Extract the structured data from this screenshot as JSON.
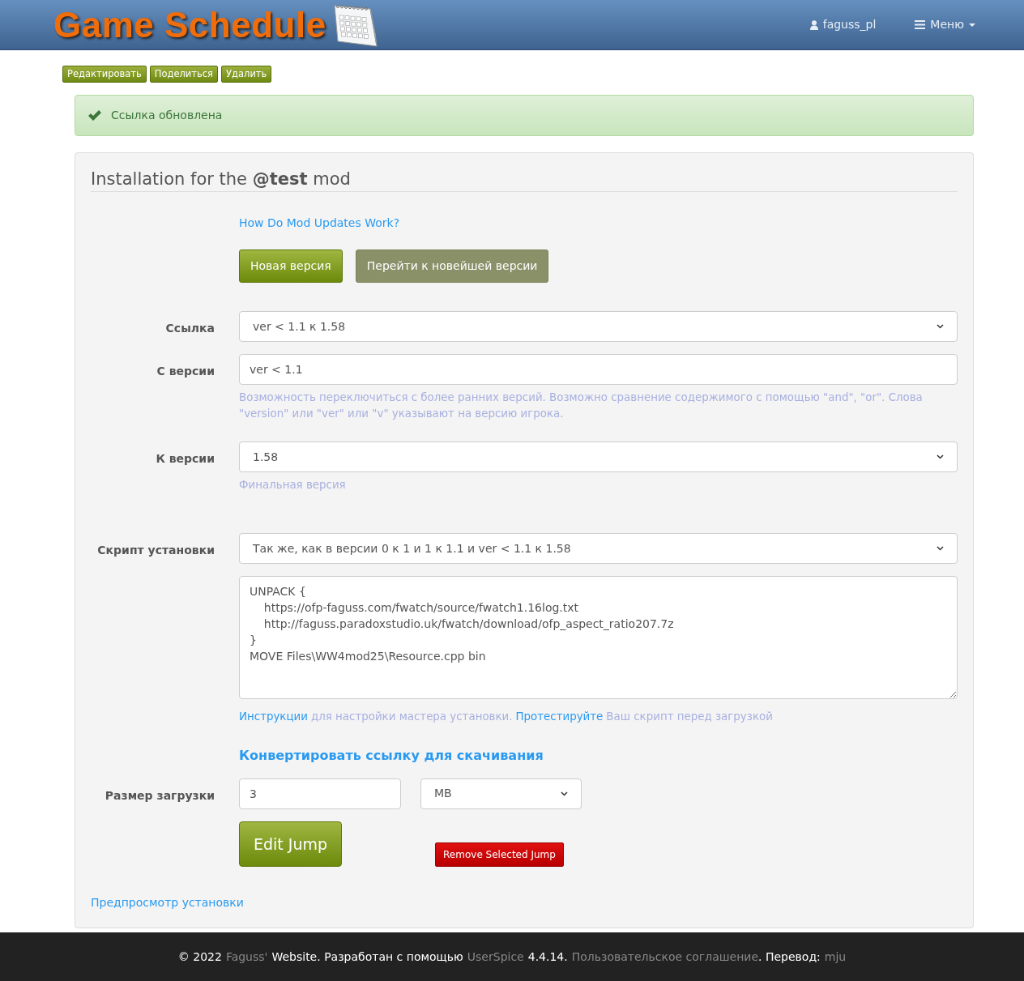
{
  "header": {
    "logo": "Game Schedule",
    "user": "faguss_pl",
    "menu": "Меню"
  },
  "toolbar": [
    "Редактировать",
    "Поделиться",
    "Удалить"
  ],
  "alert": {
    "kind": "success",
    "text": "Ссылка обновлена"
  },
  "panel": {
    "title": "Installation for the **@test** mod",
    "help_link": "How Do Mod Updates Work?",
    "buttons": [
      {
        "label": "Новая версия",
        "kind": "primary"
      },
      {
        "label": "Перейти к новейшей версии",
        "kind": "muted"
      }
    ],
    "fields": [
      {
        "kind": "select",
        "label": "Ссылка",
        "value": "ver < 1.1 к 1.58"
      },
      {
        "kind": "input",
        "label": "С версии",
        "value": "ver < 1.1",
        "help": [
          {
            "text": "Возможность переключиться с более ранних версий. Возможно сравнение содержимого с помощью \"and\", \"or\". Слова \"version\" или \"ver\" или \"v\" указывают на версию игрока.",
            "link": false
          }
        ]
      },
      {
        "kind": "select",
        "label": "К версии",
        "value": "1.58",
        "help": [
          {
            "text": "Финальная версия",
            "link": false
          }
        ]
      },
      {
        "kind": "select",
        "label": "Скрипт установки",
        "value": "Так же, как в версии 0 к 1 и 1 к 1.1 и ver < 1.1 к 1.58"
      },
      {
        "kind": "textarea",
        "value": "UNPACK {\n\thttps://ofp-faguss.com/fwatch/source/fwatch1.16log.txt\n\thttp://faguss.paradoxstudio.uk/fwatch/download/ofp_aspect_ratio207.7z\n}\nMOVE Files\\WW4mod25\\Resource.cpp bin",
        "help": [
          {
            "text": "Инструкции",
            "link": true
          },
          {
            "text": "для настройки мастера установки.",
            "link": false
          },
          {
            "text": "Протестируйте",
            "link": true
          },
          {
            "text": "Ваш скрипт перед загрузкой",
            "link": false
          }
        ]
      }
    ],
    "convert_link": "Конвертировать ссылку для скачивания",
    "size": {
      "label": "Размер загрузки",
      "value": "3",
      "unit": "MB"
    },
    "edit_button": "Edit Jump",
    "remove_button": "Remove Selected Jump",
    "preview_link": "Предпросмотр установки"
  },
  "footer": [
    {
      "text": "© 2022",
      "link": false
    },
    {
      "text": "Faguss'",
      "link": true
    },
    {
      "text": "Website. Разработан с помощью",
      "link": false
    },
    {
      "text": "UserSpice",
      "link": true
    },
    {
      "text": "4.4.14.",
      "link": false
    },
    {
      "text": "Пользовательское соглашение",
      "link": true
    },
    {
      "text": ". Перевод:",
      "link": false
    },
    {
      "text": "mju",
      "link": true
    }
  ]
}
